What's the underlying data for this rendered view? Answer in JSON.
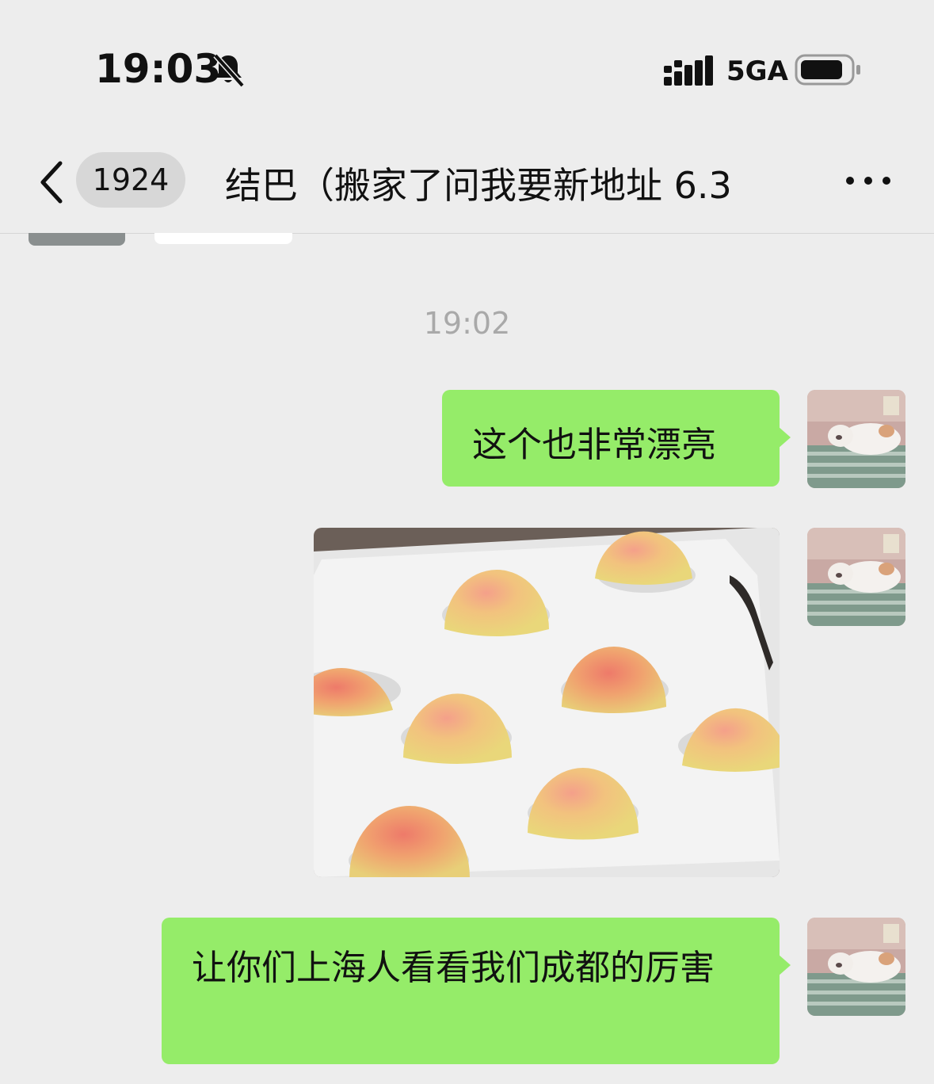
{
  "status_bar": {
    "time": "19:03",
    "network": "5GA",
    "icons": [
      "bell-slash-icon",
      "signal-bars-icon",
      "battery-icon"
    ]
  },
  "nav": {
    "back_icon": "chevron-left-icon",
    "unread_count": "1924",
    "title": "结巴（搬家了问我要新地址 6.3",
    "more_icon": "more-dots-icon"
  },
  "chat": {
    "timestamp": "19:02",
    "messages": [
      {
        "type": "text",
        "from": "me",
        "text": "这个也非常漂亮"
      },
      {
        "type": "image",
        "from": "me",
        "content": "peaches-in-foam-box"
      },
      {
        "type": "text",
        "from": "me",
        "text": "让你们上海人看看我们成都的厉害"
      }
    ]
  },
  "colors": {
    "background": "#ededed",
    "bubble_self": "#95ec69",
    "timestamp": "#a9a9a9"
  }
}
